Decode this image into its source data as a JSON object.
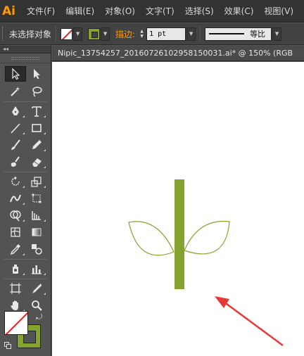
{
  "app": {
    "logo": "Ai"
  },
  "menu": {
    "items": [
      "文件(F)",
      "编辑(E)",
      "对象(O)",
      "文字(T)",
      "选择(S)",
      "效果(C)",
      "视图(V)"
    ]
  },
  "control_bar": {
    "selection_label": "未选择对象",
    "fill_color": "none",
    "stroke_color": "#86a32f",
    "stroke_label": "描边:",
    "stroke_weight": "1 pt",
    "profile_label": "等比"
  },
  "document": {
    "tab_title": "Nipic_13754257_20160726102958150031.ai*  @ 150%  (RGB"
  },
  "toolbox": {
    "tools": [
      [
        "selection-tool-icon",
        "direct-selection-tool-icon"
      ],
      [
        "magic-wand-tool-icon",
        "lasso-tool-icon"
      ],
      [
        "pen-tool-icon",
        "type-tool-icon"
      ],
      [
        "line-segment-tool-icon",
        "rectangle-tool-icon"
      ],
      [
        "paintbrush-tool-icon",
        "pencil-tool-icon"
      ],
      [
        "blob-brush-tool-icon",
        "eraser-tool-icon"
      ],
      [
        "rotate-tool-icon",
        "scale-tool-icon"
      ],
      [
        "width-tool-icon",
        "free-transform-tool-icon"
      ],
      [
        "shape-builder-tool-icon",
        "perspective-grid-tool-icon"
      ],
      [
        "mesh-tool-icon",
        "gradient-tool-icon"
      ],
      [
        "eyedropper-tool-icon",
        "blend-tool-icon"
      ],
      [
        "symbol-sprayer-tool-icon",
        "column-graph-tool-icon"
      ],
      [
        "artboard-tool-icon",
        "slice-tool-icon"
      ],
      [
        "hand-tool-icon",
        "zoom-tool-icon"
      ]
    ],
    "big_fill": "none",
    "big_stroke": "#86a32f"
  },
  "artwork": {
    "stem_color": "#86a32f",
    "leaf_stroke_color": "#86a32f",
    "arrow_color": "#e53935"
  }
}
